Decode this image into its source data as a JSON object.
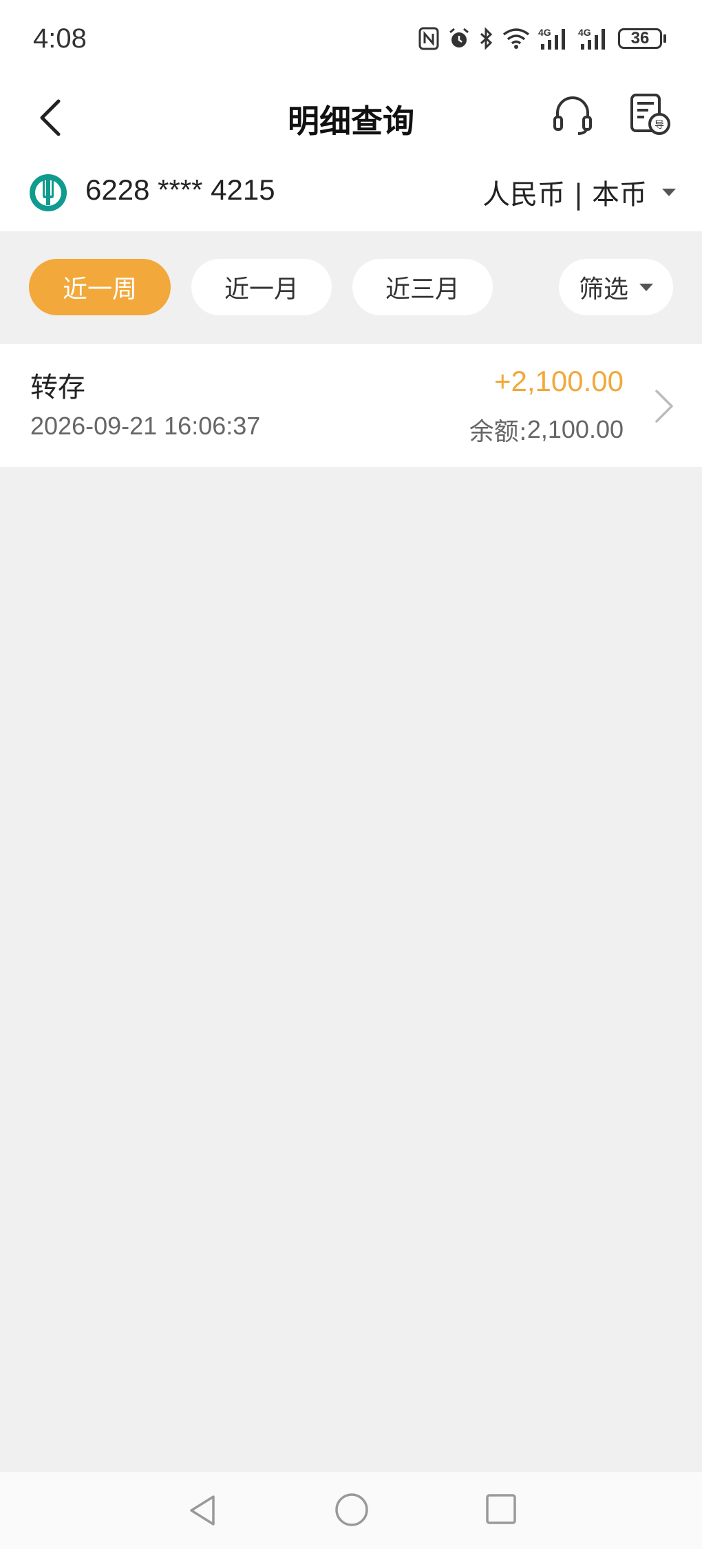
{
  "status_bar": {
    "time": "4:08",
    "battery": "36",
    "network_1": "4G",
    "network_2": "4G"
  },
  "nav": {
    "title": "明细查询",
    "back_icon": "chevron-left-icon",
    "service_icon": "headset-icon",
    "export_icon": "export-document-icon"
  },
  "account": {
    "number": "6228 **** 4215",
    "currency": "人民币 | 本币",
    "bank_logo_icon": "bank-logo-icon",
    "brand_color": "#0f9b8e"
  },
  "filters": {
    "chips": [
      {
        "label": "近一周",
        "active": true
      },
      {
        "label": "近一月",
        "active": false
      },
      {
        "label": "近三月",
        "active": false
      }
    ],
    "filter_label": "筛选",
    "accent_color": "#f2a83a"
  },
  "transactions": [
    {
      "type": "转存",
      "time": "2026-09-21 16:06:37",
      "amount": "+2,100.00",
      "balance_label": "余额:",
      "balance_value": "2,100.00"
    }
  ]
}
